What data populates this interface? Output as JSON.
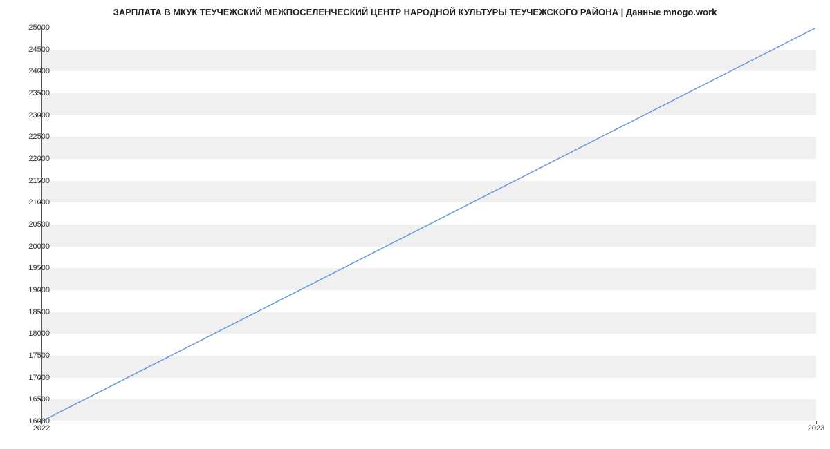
{
  "chart_data": {
    "type": "line",
    "title": "ЗАРПЛАТА В МКУК ТЕУЧЕЖСКИЙ МЕЖПОСЕЛЕНЧЕСКИЙ ЦЕНТР НАРОДНОЙ КУЛЬТУРЫ ТЕУЧЕЖСКОГО РАЙОНА | Данные mnogo.work",
    "x": [
      2022,
      2023
    ],
    "values": [
      16000,
      25000
    ],
    "xlabel": "",
    "ylabel": "",
    "xlim": [
      2022,
      2023
    ],
    "ylim": [
      16000,
      25000
    ],
    "y_ticks": [
      16000,
      16500,
      17000,
      17500,
      18000,
      18500,
      19000,
      19500,
      20000,
      20500,
      21000,
      21500,
      22000,
      22500,
      23000,
      23500,
      24000,
      24500,
      25000
    ],
    "x_ticks": [
      2022,
      2023
    ],
    "line_color": "#6699dd",
    "band_color": "#f0f0f0"
  }
}
